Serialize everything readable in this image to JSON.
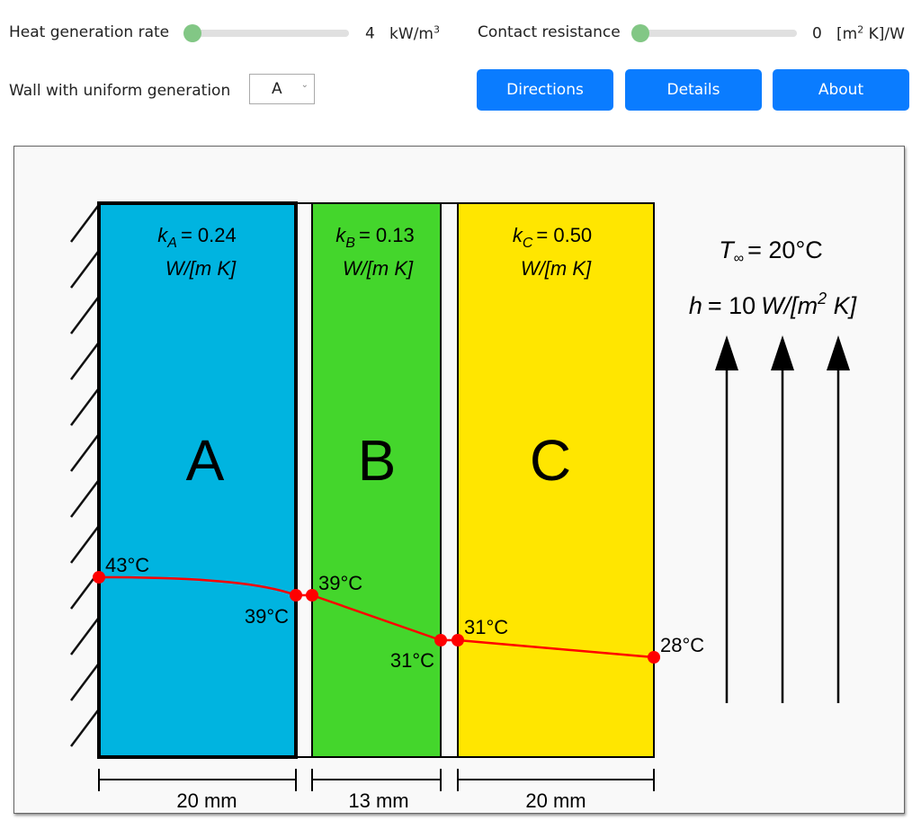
{
  "controls": {
    "heat_generation": {
      "label": "Heat generation rate",
      "value": "4",
      "unit_base": "kW/m",
      "unit_sup": "3",
      "slider_fraction": 0.0
    },
    "contact_resistance": {
      "label": "Contact resistance",
      "value": "0",
      "unit_pre": "[m",
      "unit_sup": "2",
      "unit_post": " K]/W",
      "slider_fraction": 0.0
    },
    "wall_select": {
      "label": "Wall with uniform generation",
      "value": "A"
    }
  },
  "buttons": {
    "directions": "Directions",
    "details": "Details",
    "about": "About"
  },
  "diagram": {
    "colors": {
      "wall_a": "#00b4e0",
      "wall_b": "#44d62c",
      "wall_c": "#ffe600",
      "profile": "#ff0000",
      "background": "#f9f9f9"
    },
    "walls": [
      {
        "name": "A",
        "k_sym": "k",
        "k_sub": "A",
        "k_value": "= 0.24",
        "k_unit": "W/[m K]",
        "thickness": "20 mm"
      },
      {
        "name": "B",
        "k_sym": "k",
        "k_sub": "B",
        "k_value": "= 0.13",
        "k_unit": "W/[m K]",
        "thickness": "13 mm"
      },
      {
        "name": "C",
        "k_sym": "k",
        "k_sub": "C",
        "k_value": "= 0.50",
        "k_unit": "W/[m K]",
        "thickness": "20 mm"
      }
    ],
    "ambient": {
      "t_sym": "T",
      "t_sub": "∞",
      "t_value": "= 20°C",
      "h_sym": "h",
      "h_value": "= 10",
      "h_unit_pre": "W/[m",
      "h_unit_sup": "2",
      "h_unit_post": " K]"
    },
    "temperatures": {
      "a_left": "43°C",
      "a_right": "39°C",
      "b_left": "39°C",
      "b_right": "31°C",
      "c_left": "31°C",
      "c_right": "28°C"
    }
  }
}
